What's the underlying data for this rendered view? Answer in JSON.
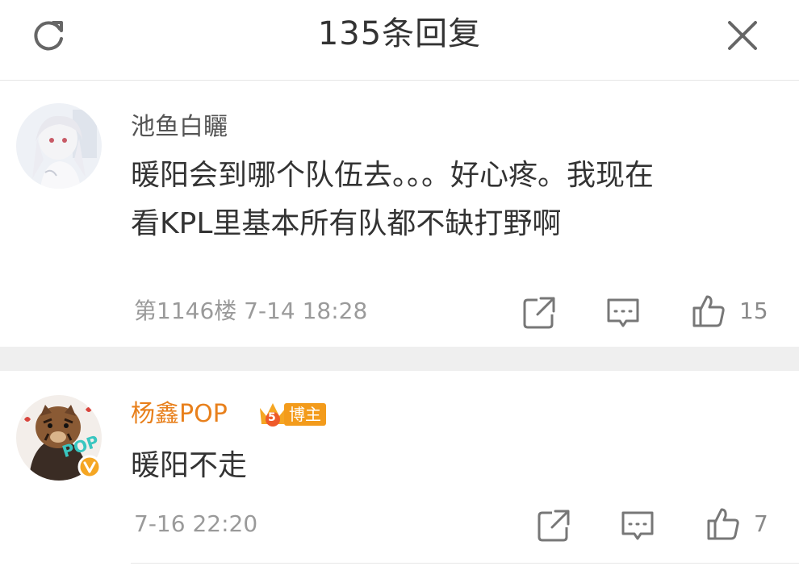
{
  "header": {
    "title": "135条回复",
    "refresh_icon": "refresh-icon",
    "close_icon": "close-icon"
  },
  "comments": [
    {
      "username": "池鱼白矖",
      "text_lines": [
        "暖阳会到哪个队伍去。。。好心疼。我现在",
        "看KPL里基本所有队都不缺打野啊"
      ],
      "meta": "第1146楼 7-14 18:28",
      "likes": "15",
      "avatar": "anime-avatar"
    },
    {
      "username": "杨鑫POP",
      "badge_level": "5",
      "badge_label": "博主",
      "text_lines": [
        "暖阳不走"
      ],
      "meta": "7-16 22:20",
      "likes": "7",
      "avatar": "tiger-avatar"
    }
  ],
  "colors": {
    "username_vip": "#e8801c",
    "badge": "#f39b1b",
    "divider": "#efefef",
    "meta": "#9a9a9a"
  }
}
